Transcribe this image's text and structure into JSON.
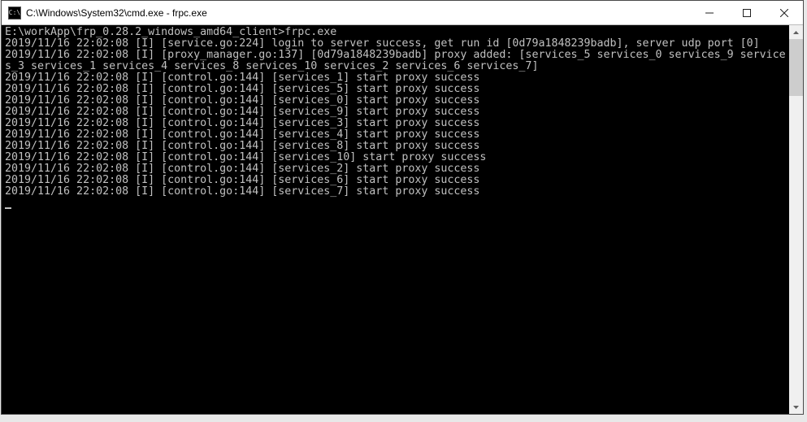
{
  "titlebar": {
    "icon_label": "C:\\",
    "title": "C:\\Windows\\System32\\cmd.exe - frpc.exe"
  },
  "console": {
    "prompt_line": "E:\\workApp\\frp_0.28.2_windows_amd64_client>frpc.exe",
    "login_line": "2019/11/16 22:02:08 [I] [service.go:224] login to server success, get run id [0d79a1848239badb], server udp port [0]",
    "proxy_added_line": "2019/11/16 22:02:08 [I] [proxy_manager.go:137] [0d79a1848239badb] proxy added: [services_5 services_0 services_9 services_3 services_1 services_4 services_8 services_10 services_2 services_6 services_7]",
    "proxy_success": [
      "2019/11/16 22:02:08 [I] [control.go:144] [services_1] start proxy success",
      "2019/11/16 22:02:08 [I] [control.go:144] [services_5] start proxy success",
      "2019/11/16 22:02:08 [I] [control.go:144] [services_0] start proxy success",
      "2019/11/16 22:02:08 [I] [control.go:144] [services_9] start proxy success",
      "2019/11/16 22:02:08 [I] [control.go:144] [services_3] start proxy success",
      "2019/11/16 22:02:08 [I] [control.go:144] [services_4] start proxy success",
      "2019/11/16 22:02:08 [I] [control.go:144] [services_8] start proxy success",
      "2019/11/16 22:02:08 [I] [control.go:144] [services_10] start proxy success",
      "2019/11/16 22:02:08 [I] [control.go:144] [services_2] start proxy success",
      "2019/11/16 22:02:08 [I] [control.go:144] [services_6] start proxy success",
      "2019/11/16 22:02:08 [I] [control.go:144] [services_7] start proxy success"
    ]
  }
}
